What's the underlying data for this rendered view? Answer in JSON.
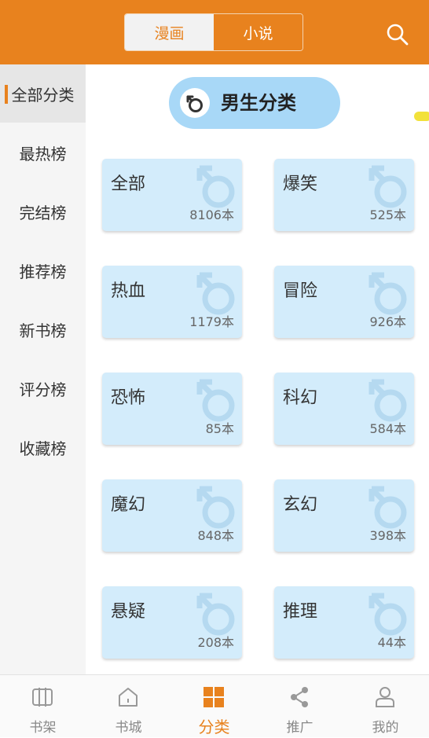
{
  "header": {
    "tabs": [
      "漫画",
      "小说"
    ],
    "active_tab": "漫画",
    "search_icon": "search-icon",
    "color": "#e8821e"
  },
  "sidebar": {
    "items": [
      {
        "label": "全部分类",
        "active": true
      },
      {
        "label": "最热榜"
      },
      {
        "label": "完结榜"
      },
      {
        "label": "推荐榜"
      },
      {
        "label": "新书榜"
      },
      {
        "label": "评分榜"
      },
      {
        "label": "收藏榜"
      }
    ]
  },
  "main": {
    "banner": {
      "title": "男生分类",
      "icon": "male-symbol-icon"
    },
    "categories": [
      {
        "name": "全部",
        "count": "8106本"
      },
      {
        "name": "爆笑",
        "count": "525本"
      },
      {
        "name": "热血",
        "count": "1179本"
      },
      {
        "name": "冒险",
        "count": "926本"
      },
      {
        "name": "恐怖",
        "count": "85本"
      },
      {
        "name": "科幻",
        "count": "584本"
      },
      {
        "name": "魔幻",
        "count": "848本"
      },
      {
        "name": "玄幻",
        "count": "398本"
      },
      {
        "name": "悬疑",
        "count": "208本"
      },
      {
        "name": "推理",
        "count": "44本"
      }
    ]
  },
  "bottom_nav": {
    "items": [
      {
        "label": "书架",
        "icon": "bookshelf-icon"
      },
      {
        "label": "书城",
        "icon": "home-icon"
      },
      {
        "label": "分类",
        "icon": "category-grid-icon",
        "active": true
      },
      {
        "label": "推广",
        "icon": "share-icon"
      },
      {
        "label": "我的",
        "icon": "profile-icon"
      }
    ]
  }
}
